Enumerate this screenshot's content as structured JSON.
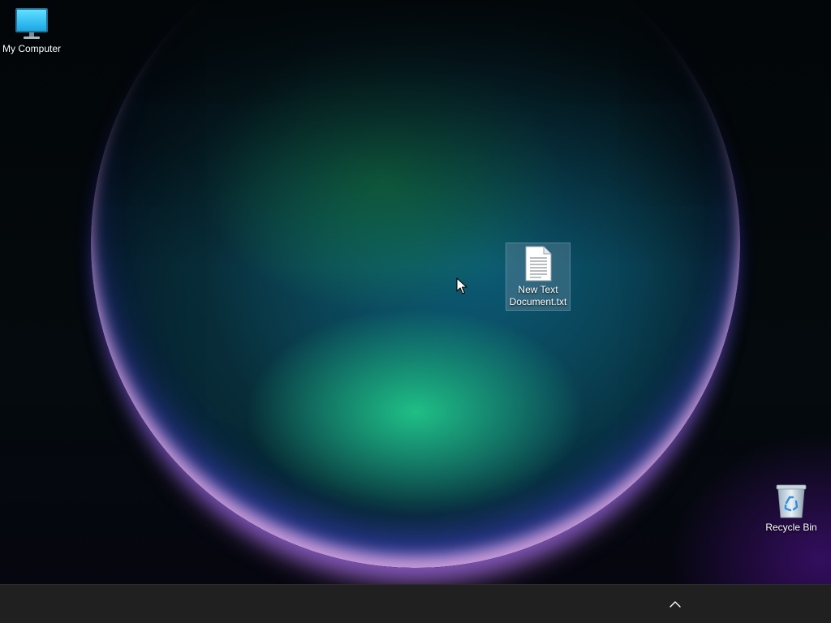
{
  "desktop": {
    "icons": [
      {
        "label": "My Computer",
        "icon": "monitor-icon"
      },
      {
        "label": "New Text Document.txt",
        "icon": "text-document-icon",
        "selected": true
      },
      {
        "label": "Recycle Bin",
        "icon": "recycle-bin-icon"
      }
    ]
  },
  "taskbar": {
    "tray": {
      "icon": "chevron-up-icon"
    }
  }
}
